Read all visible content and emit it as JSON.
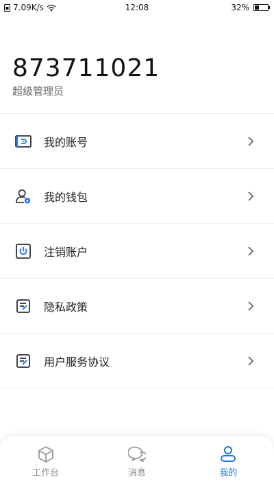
{
  "status_bar": {
    "speed": "7.09K/s",
    "time": "12:08",
    "battery": "32%",
    "battery_level": 0.32
  },
  "profile": {
    "id": "873711021",
    "role": "超级管理员"
  },
  "menu": [
    {
      "label": "我的账号",
      "icon": "account-card-icon"
    },
    {
      "label": "我的钱包",
      "icon": "wallet-user-icon"
    },
    {
      "label": "注销账户",
      "icon": "power-off-icon"
    },
    {
      "label": "隐私政策",
      "icon": "document-edit-icon"
    },
    {
      "label": "用户服务协议",
      "icon": "document-edit-icon"
    }
  ],
  "tabbar": {
    "tabs": [
      {
        "label": "工作台",
        "icon": "cube-icon",
        "active": false
      },
      {
        "label": "消息",
        "icon": "chat-bubble-icon",
        "active": false
      },
      {
        "label": "我的",
        "icon": "user-icon",
        "active": true
      }
    ]
  },
  "colors": {
    "accent": "#1a73e8",
    "icon_dark": "#2b2f3a",
    "inactive": "#888888",
    "divider": "#eeeeee"
  }
}
